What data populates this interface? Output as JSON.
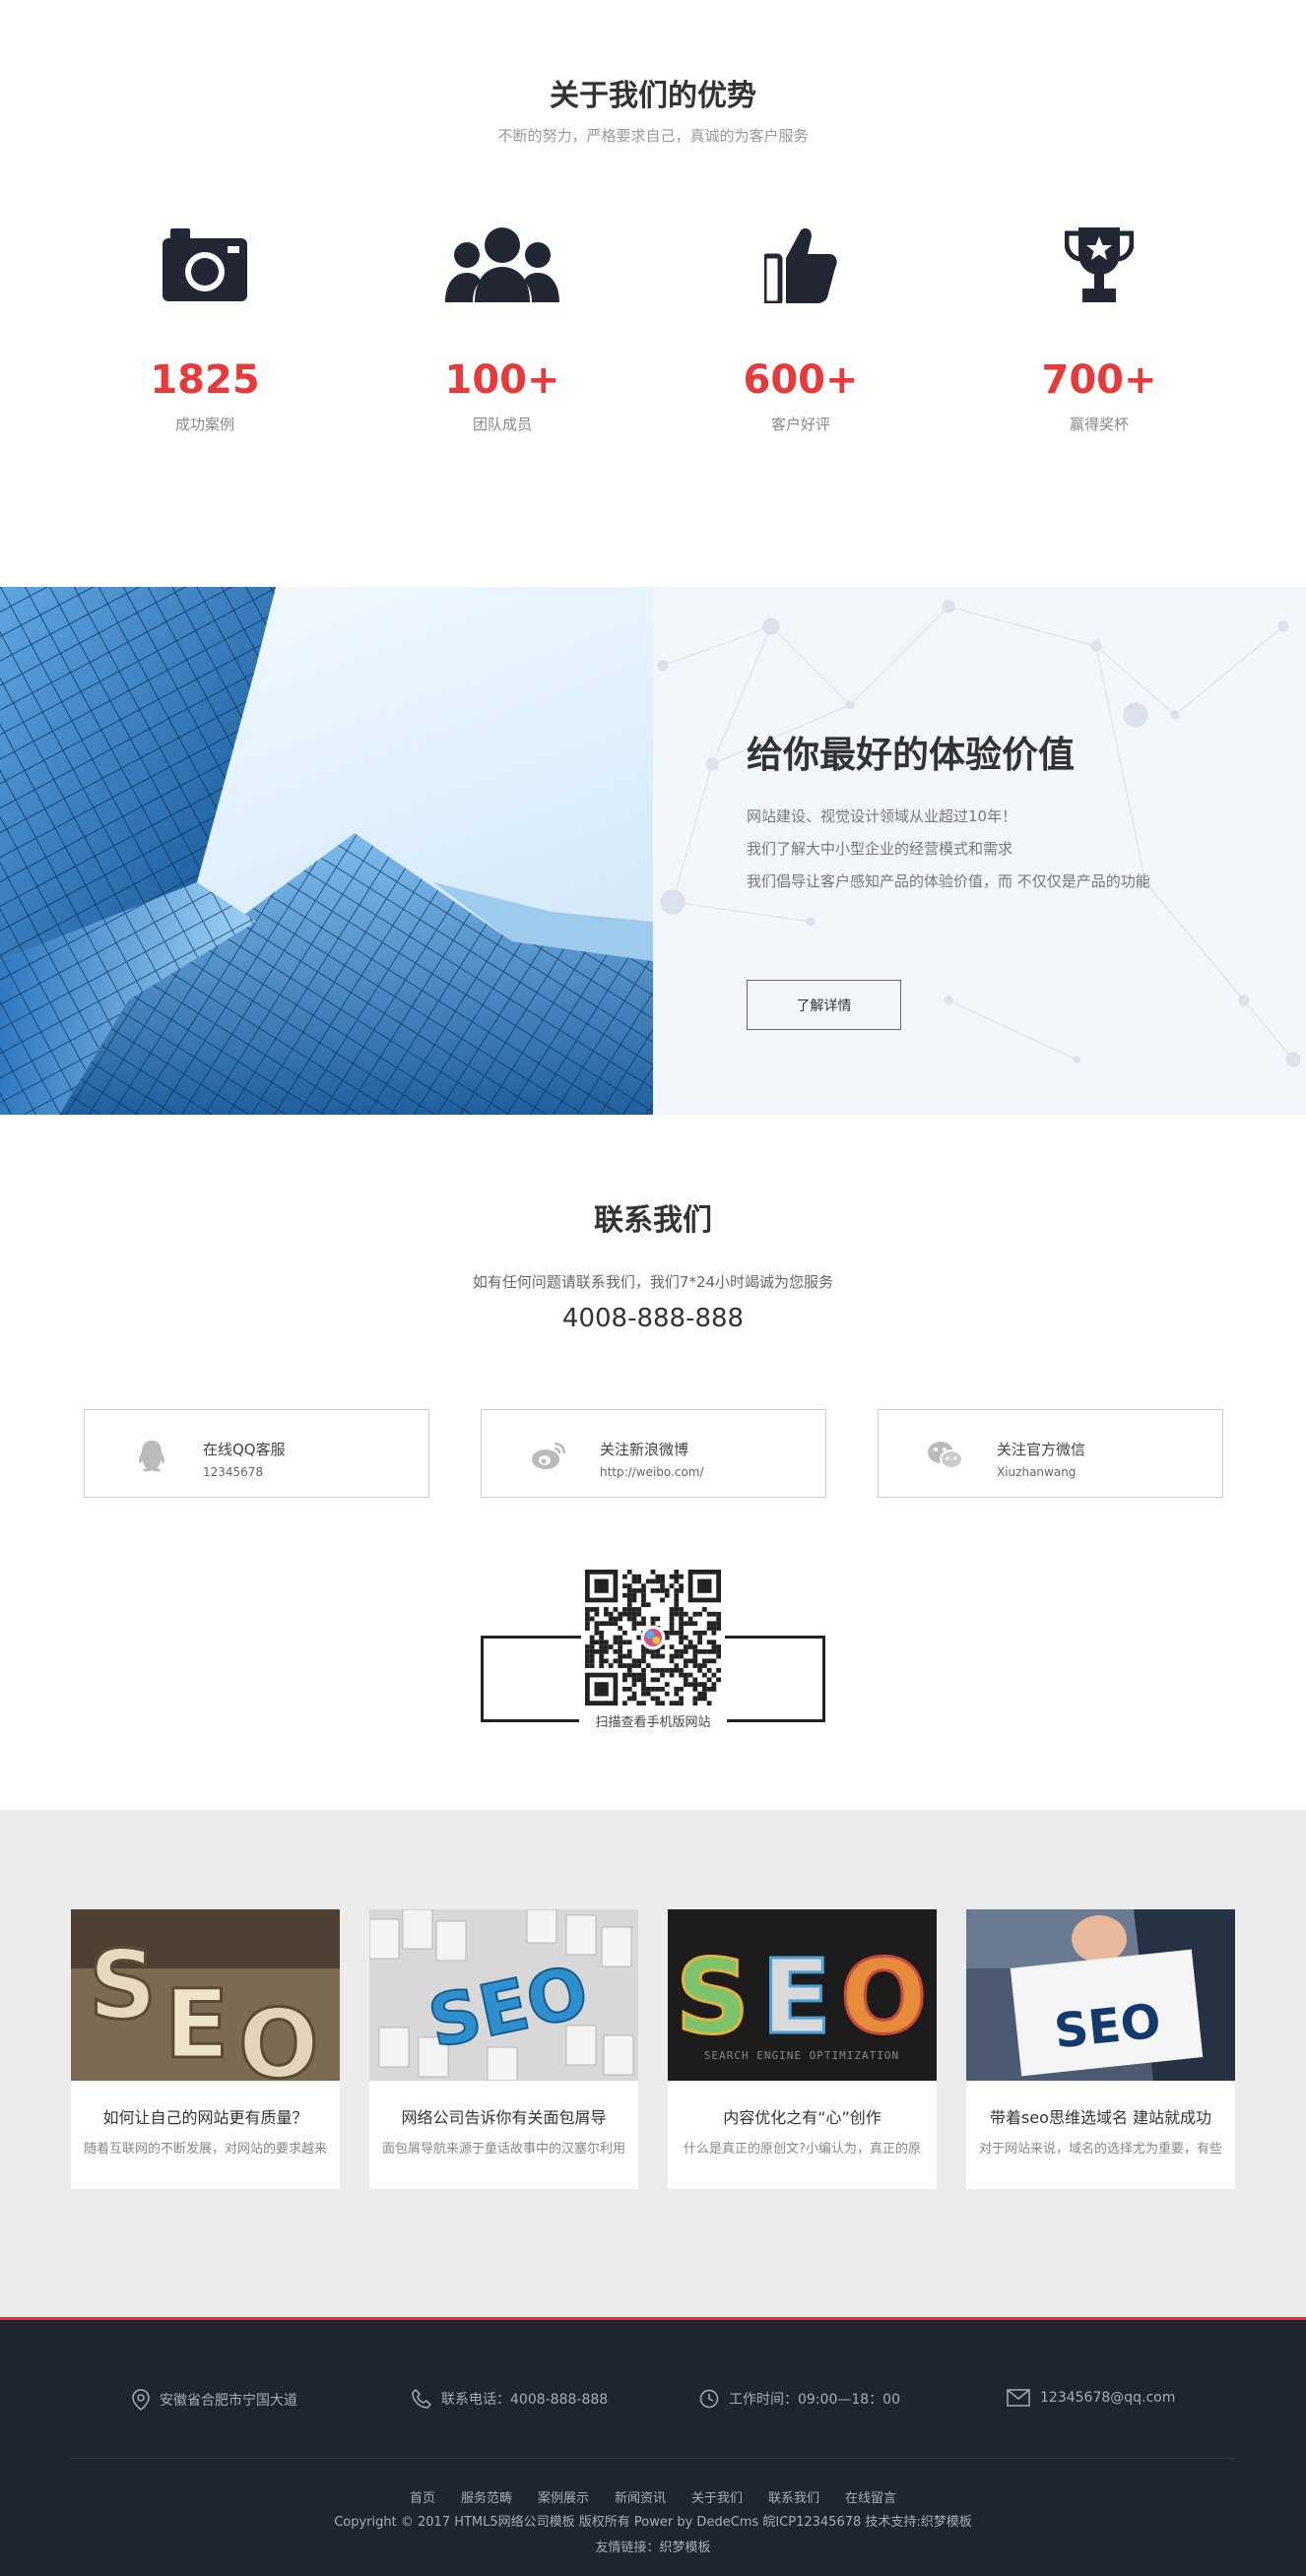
{
  "advantages": {
    "title": "关于我们的优势",
    "subtitle": "不断的努力，严格要求自己，真诚的为客户服务",
    "stats": [
      {
        "icon": "camera-icon",
        "value": "1825",
        "label": "成功案例"
      },
      {
        "icon": "team-icon",
        "value": "100+",
        "label": "团队成员"
      },
      {
        "icon": "thumbs-up-icon",
        "value": "600+",
        "label": "客户好评"
      },
      {
        "icon": "trophy-icon",
        "value": "700+",
        "label": "赢得奖杯"
      }
    ],
    "accent_color": "#e83a3a"
  },
  "experience": {
    "title": "给你最好的体验价值",
    "lines": [
      "网站建设、视觉设计领域从业超过10年！",
      "我们了解大中小型企业的经营模式和需求",
      "我们倡导让客户感知产品的体验价值，而 不仅仅是产品的功能"
    ],
    "button": "了解详情"
  },
  "contact": {
    "title": "联系我们",
    "subtitle": "如有任何问题请联系我们，我们7*24小时竭诚为您服务",
    "phone": "4008-888-888",
    "boxes": [
      {
        "icon": "qq-icon",
        "title": "在线QQ客服",
        "sub": "12345678"
      },
      {
        "icon": "weibo-icon",
        "title": "关注新浪微博",
        "sub": "http://weibo.com/"
      },
      {
        "icon": "wechat-icon",
        "title": "关注官方微信",
        "sub": "Xiuzhanwang"
      }
    ],
    "qr_caption": "扫描查看手机版网站"
  },
  "news": [
    {
      "title": "如何让自己的网站更有质量？",
      "excerpt": "随着互联网的不断发展，对网站的要求越来"
    },
    {
      "title": "网络公司告诉你有关面包屑导",
      "excerpt": "面包屑导航来源于童话故事中的汉塞尔利用"
    },
    {
      "title": "内容优化之有“心”创作",
      "excerpt": "什么是真正的原创文?小编认为，真正的原"
    },
    {
      "title": "带着seo思维选域名 建站就成功",
      "excerpt": "对于网站来说，域名的选择尤为重要，有些"
    }
  ],
  "footer": {
    "address": "安徽省合肥市宁国大道",
    "phone": "联系电话：4008-888-888",
    "hours": "工作时间：09:00—18：00",
    "email": "12345678@qq.com",
    "nav": [
      "首页",
      "服务范畴",
      "案例展示",
      "新闻资讯",
      "关于我们",
      "联系我们",
      "在线留言"
    ],
    "copyright": "Copyright © 2017 HTML5网络公司模板 版权所有 Power by DedeCms 皖ICP12345678  技术支持:织梦模板",
    "links": "友情链接：织梦模板"
  }
}
